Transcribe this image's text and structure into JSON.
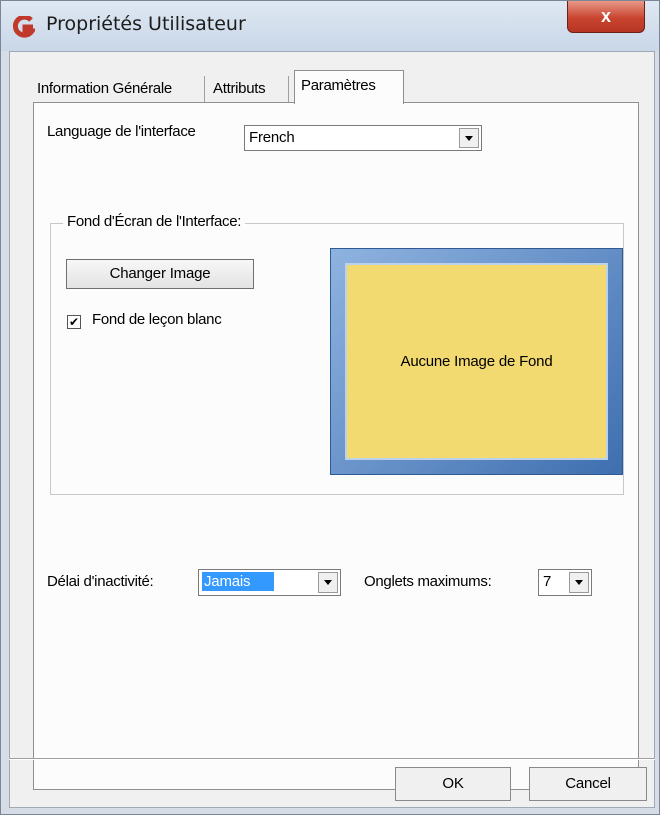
{
  "window": {
    "title": "Propriétés Utilisateur",
    "close_glyph": "x"
  },
  "tabs": [
    {
      "label": "Information Générale"
    },
    {
      "label": "Attributs"
    },
    {
      "label": "Paramètres"
    }
  ],
  "settings": {
    "language_label": "Language de l'interface",
    "language_value": "French",
    "background_group_title": "Fond d'Écran de l'Interface:",
    "change_image_label": "Changer Image",
    "white_lesson_bg_label": "Fond de leçon blanc",
    "white_lesson_bg_checked": true,
    "preview_text": "Aucune Image de Fond",
    "inactivity_label": "Délai d'inactivité:",
    "inactivity_value": "Jamais",
    "max_tabs_label": "Onglets maximums:",
    "max_tabs_value": "7"
  },
  "footer": {
    "ok_label": "OK",
    "cancel_label": "Cancel"
  },
  "colors": {
    "preview_fill": "#f2d970",
    "preview_frame": "#4a7cc0",
    "close_button": "#c8442f",
    "selection": "#3399ff"
  },
  "icons": [
    "app-logo-icon",
    "close-icon",
    "chevron-down-icon",
    "checkmark-icon"
  ]
}
